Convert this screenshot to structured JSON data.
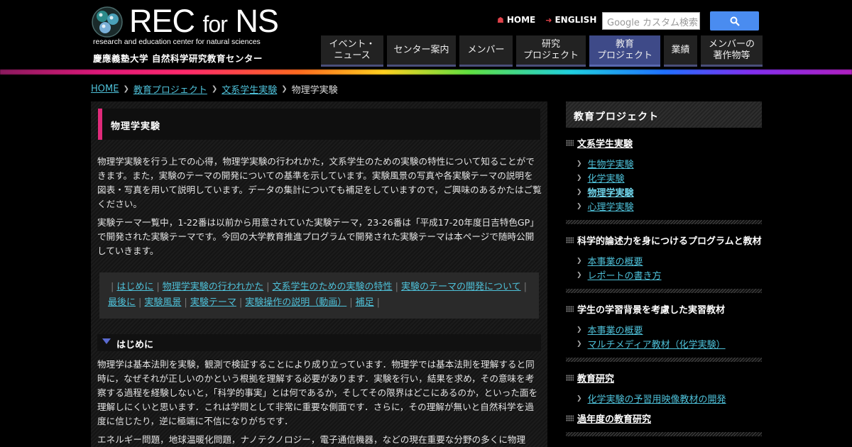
{
  "header": {
    "logo_title_main": "REC",
    "logo_title_for": "for",
    "logo_title_ns": "NS",
    "logo_subtitle": "research and education center for natural sciences",
    "logo_org": "慶應義塾大学 自然科学研究教育センター",
    "links": {
      "home": "HOME",
      "english": "ENGLISH"
    },
    "search_placeholder": "Google カスタム検索",
    "nav": [
      {
        "line1": "イベント・",
        "line2": "ニュース"
      },
      {
        "line1": "センター案内",
        "line2": ""
      },
      {
        "line1": "メンバー",
        "line2": ""
      },
      {
        "line1": "研究",
        "line2": "プロジェクト"
      },
      {
        "line1": "教育",
        "line2": "プロジェクト"
      },
      {
        "line1": "業績",
        "line2": ""
      },
      {
        "line1": "メンバーの",
        "line2": "著作物等"
      }
    ]
  },
  "breadcrumb": {
    "home": "HOME",
    "level1": "教育プロジェクト",
    "level2": "文系学生実験",
    "current": "物理学実験"
  },
  "main": {
    "page_title": "物理学実験",
    "intro1": "物理学実験を行う上での心得，物理学実験の行われかた，文系学生のための実験の特性について知ることができます。また，実験のテーマの開発についての基準を示しています。実験風景の写真や各実験テーマの説明を図表・写真を用いて説明しています。データの集計についても補足をしていますので，ご興味のあるかたはご覧ください。",
    "intro2": "実験テーマ一覧中，1-22番は以前から用意されていた実験テーマ，23-26番は「平成17-20年度日吉特色GP」で開発された実験テーマです。今回の大学教育推進プログラムで開発された実験テーマは本ページで随時公開していきます。",
    "toc": [
      "はじめに",
      "物理学実験の行われかた",
      "文系学生のための実験の特性",
      "実験のテーマの開発について",
      "最後に",
      "実験風景",
      "実験テーマ",
      "実験操作の説明（動画）",
      "補足"
    ],
    "section_title": "はじめに",
    "section_p1": "物理学は基本法則を実験，観測で検証することにより成り立っています．物理学では基本法則を理解すると同時に，なぜそれが正しいのかという根拠を理解する必要があります．実験を行い，結果を求め，その意味を考察する過程を経験しないと，「科学的事実」とは何であるか，そしてその限界はどこにあるのか，といった面を理解しにくいと思います．これは学問として非常に重要な側面です．さらに，その理解が無いと自然科学を過度に信じたり，逆に極端に不信になりがちです．",
    "section_p2": "エネルギー問題，地球温暖化問題，ナノテクノロジー，電子通信機器，などの現在重要な分野の多くに物理"
  },
  "sidebar": {
    "title": "教育プロジェクト",
    "cat1": "文系学生実験",
    "cat1_items": [
      "生物学実験",
      "化学実験",
      "物理学実験",
      "心理学実験"
    ],
    "cat2": "科学的論述力を身につけるプログラムと教材",
    "cat2_items": [
      "本事業の概要",
      "レポートの書き方"
    ],
    "cat3": "学生の学習背景を考慮した実習教材",
    "cat3_items": [
      "本事業の概要",
      "マルチメディア教材（化学実験）"
    ],
    "cat4": "教育研究",
    "cat4_items": [
      "化学実験の予習用映像教材の開発"
    ],
    "cat5": "過年度の教育研究"
  },
  "colors": {
    "accent_pink": "#e02a7a",
    "link": "#4ec0d8",
    "nav_active": "#3e4a88",
    "search_button": "#4a8cf0"
  }
}
